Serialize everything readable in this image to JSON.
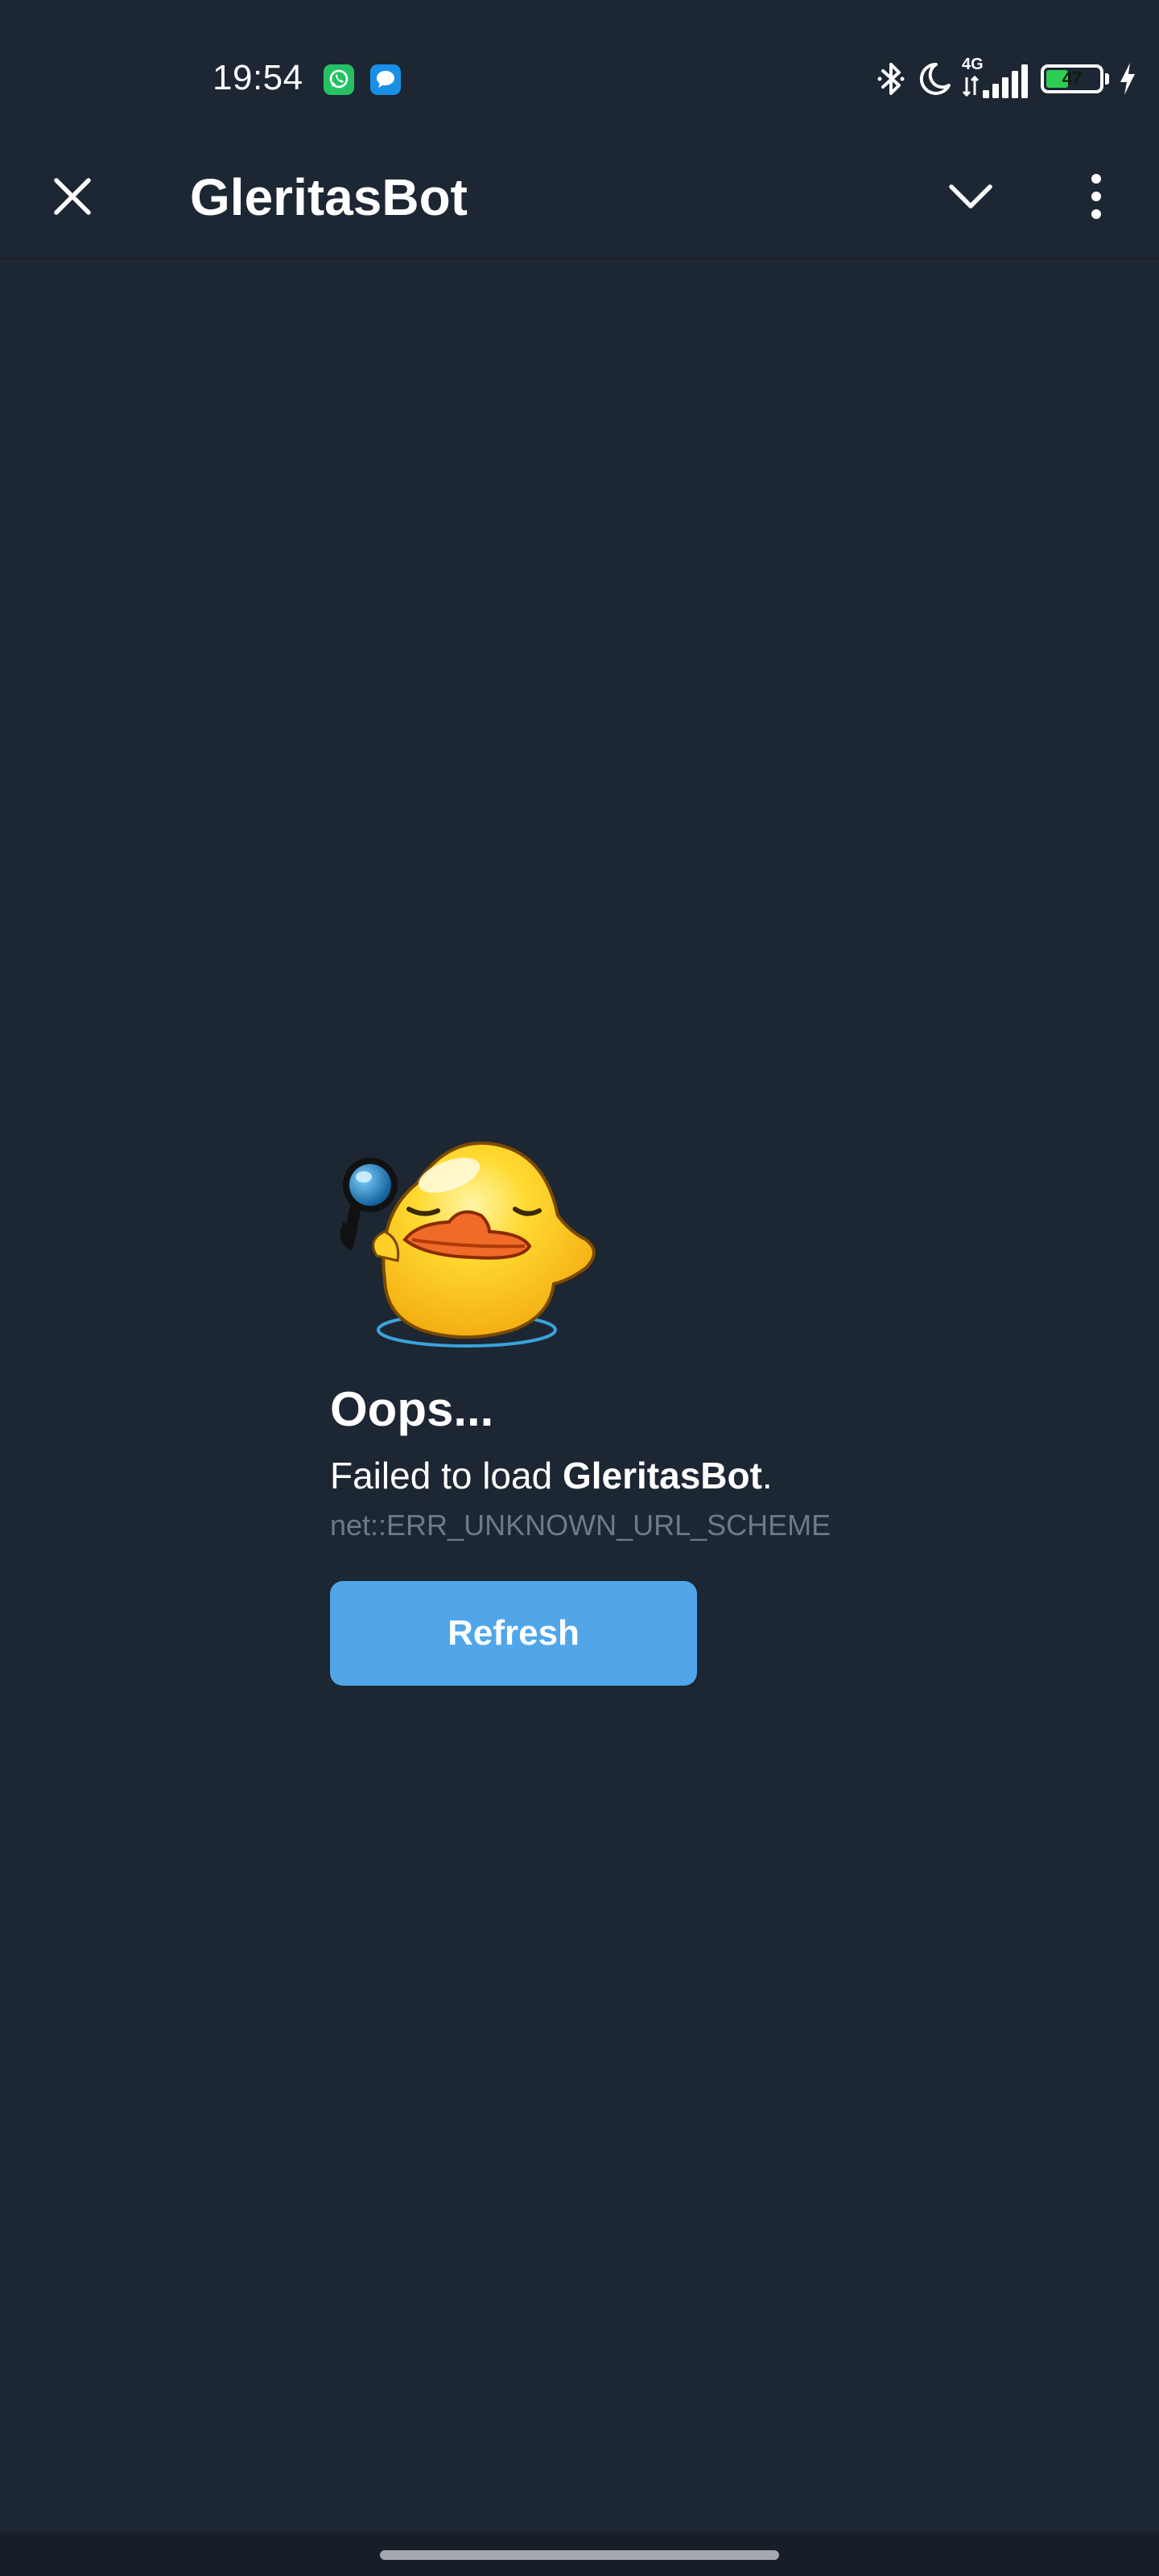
{
  "status_bar": {
    "time": "19:54",
    "network": "4G",
    "battery_level": "47",
    "icons": [
      "whatsapp-icon",
      "messages-icon",
      "bluetooth-icon",
      "do-not-disturb-moon-icon",
      "cellular-signal-icon",
      "battery-icon",
      "charging-bolt-icon"
    ]
  },
  "header": {
    "title": "GleritasBot",
    "close_icon": "close-icon",
    "collapse_icon": "chevron-down-icon",
    "menu_icon": "more-vertical-icon"
  },
  "error": {
    "sticker": "duck-with-magnifier-sticker",
    "title": "Oops...",
    "message_prefix": "Failed to load ",
    "message_bot": "GleritasBot",
    "message_suffix": ".",
    "code": "net::ERR_UNKNOWN_URL_SCHEME",
    "refresh_label": "Refresh"
  },
  "colors": {
    "background": "#1d2633",
    "button": "#50a6e9",
    "muted_text": "#6d7a89",
    "battery_fill": "#2ecc52"
  }
}
